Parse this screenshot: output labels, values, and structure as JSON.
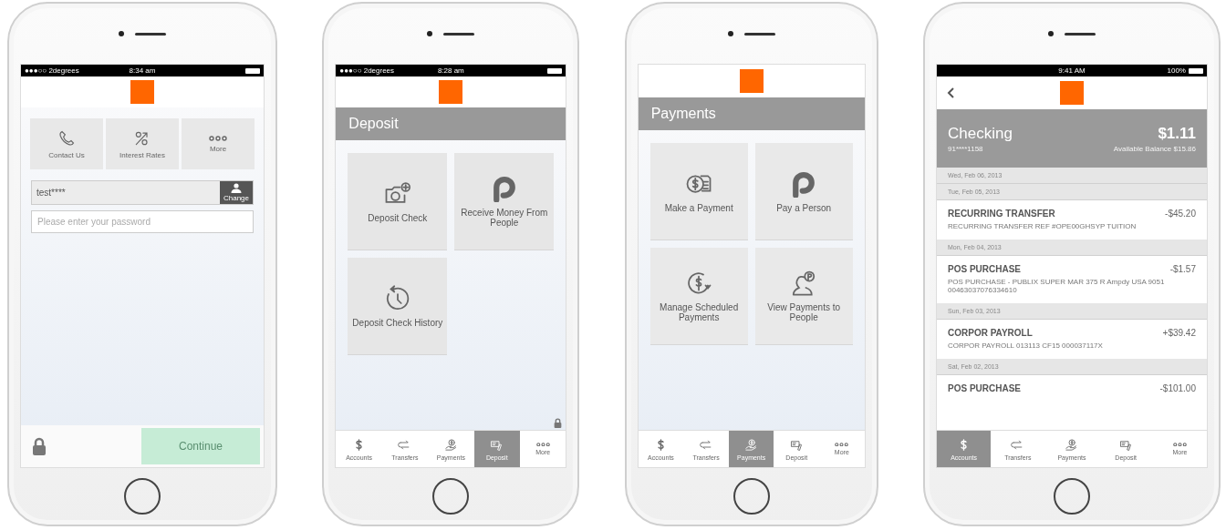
{
  "phones": [
    {
      "kind": "login",
      "status_bar": {
        "carrier": "●●●○○ 2degrees",
        "time": "8:34 am"
      },
      "quick_actions": [
        {
          "label": "Contact Us"
        },
        {
          "label": "Interest Rates"
        },
        {
          "label": "More"
        }
      ],
      "username_field": {
        "value": "test****",
        "button_label": "Change"
      },
      "password_field": {
        "placeholder": "Please enter your password"
      },
      "continue_button": {
        "label": "Continue",
        "disabled": true
      }
    },
    {
      "kind": "menu",
      "status_bar": {
        "carrier": "●●●○○ 2degrees",
        "time": "8:28 am"
      },
      "title": "Deposit",
      "tiles": [
        {
          "label": "Deposit Check"
        },
        {
          "label": "Receive Money From People"
        },
        {
          "label": "Deposit Check History"
        }
      ],
      "show_lock": true,
      "tab_bar": [
        {
          "label": "Accounts",
          "selected": false
        },
        {
          "label": "Transfers",
          "selected": false
        },
        {
          "label": "Payments",
          "selected": false
        },
        {
          "label": "Deposit",
          "selected": true
        },
        {
          "label": "More",
          "selected": false
        }
      ]
    },
    {
      "kind": "menu",
      "title": "Payments",
      "tiles": [
        {
          "label": "Make a Payment"
        },
        {
          "label": "Pay a Person"
        },
        {
          "label": "Manage Scheduled Payments"
        },
        {
          "label": "View Payments to People"
        }
      ],
      "show_lock": false,
      "tab_bar": [
        {
          "label": "Accounts",
          "selected": false
        },
        {
          "label": "Transfers",
          "selected": false
        },
        {
          "label": "Payments",
          "selected": true
        },
        {
          "label": "Deposit",
          "selected": false
        },
        {
          "label": "More",
          "selected": false
        }
      ]
    },
    {
      "kind": "account",
      "status_bar": {
        "time": "9:41 AM",
        "battery": "100%"
      },
      "account": {
        "name": "Checking",
        "number": "91****1158",
        "balance": "$1.11",
        "available": "Available Balance $15.86"
      },
      "sections": [
        {
          "date": "Wed, Feb 06, 2013"
        },
        {
          "date": "Tue, Feb 05, 2013",
          "transactions": [
            {
              "title": "RECURRING TRANSFER",
              "amount": "-$45.20",
              "description": "RECURRING TRANSFER REF #OPE00GHSYP TUITION"
            }
          ]
        },
        {
          "date": "Mon, Feb 04, 2013",
          "transactions": [
            {
              "title": "POS PURCHASE",
              "amount": "-$1.57",
              "description": "POS PURCHASE - PUBLIX SUPER MAR 375 R Ampdy USA 9051 00463037076334610"
            }
          ]
        },
        {
          "date": "Sun, Feb 03, 2013",
          "transactions": [
            {
              "title": "CORPOR PAYROLL",
              "amount": "+$39.42",
              "description": "CORPOR PAYROLL 013113 CF15 000037117X"
            }
          ]
        },
        {
          "date": "Sat, Feb 02, 2013",
          "transactions": [
            {
              "title": "POS PURCHASE",
              "amount": "-$101.00"
            }
          ]
        }
      ],
      "tab_bar": [
        {
          "label": "Accounts",
          "selected": true
        },
        {
          "label": "Transfers",
          "selected": false
        },
        {
          "label": "Payments",
          "selected": false
        },
        {
          "label": "Deposit",
          "selected": false
        },
        {
          "label": "More",
          "selected": false
        }
      ]
    }
  ]
}
